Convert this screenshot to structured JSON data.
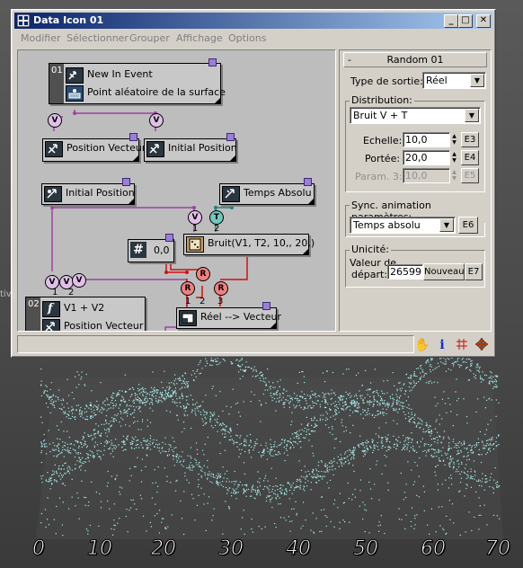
{
  "window": {
    "title": "Data Icon 01",
    "buttons": {
      "minimize": "_",
      "maximize": "□",
      "close": "✕"
    }
  },
  "menu": [
    "Modifier",
    "Sélectionner",
    "Grouper",
    "Affichage",
    "Options"
  ],
  "graph": {
    "node_new_event": {
      "id": "01",
      "line1": "New In Event",
      "line2": "Point aléatoire de la surface"
    },
    "node_pos_vect_1": {
      "label": "Position Vecteur"
    },
    "node_initial_pos_1": {
      "label": "Initial Position"
    },
    "node_initial_pos_2": {
      "label": "Initial Position"
    },
    "node_temps_absolu": {
      "label": "Temps Absolu"
    },
    "node_constant": {
      "icon_text": "#",
      "value": "0,0"
    },
    "node_noise": {
      "label": "Bruit(V1, T2, 10,, 20,)"
    },
    "node_output": {
      "id": "02",
      "line1": "V1 + V2",
      "line2": "Position Vecteur"
    },
    "node_real_vect": {
      "label": "Réel --> Vecteur"
    },
    "circles": {
      "v": "V",
      "t": "T",
      "r": "R"
    },
    "port_numbers": {
      "one": "1",
      "two": "2",
      "three": "3"
    }
  },
  "panel": {
    "rollout_title": "Random 01",
    "rollout_toggle": "-",
    "output_type_label": "Type de sortie:",
    "output_type_value": "Réel",
    "distribution_label": "Distribution:",
    "distribution_value": "Bruit V + T",
    "scale_label": "Echelle:",
    "scale_value": "10,0",
    "scale_btn": "E3",
    "range_label": "Portée:",
    "range_value": "20,0",
    "range_btn": "E4",
    "param3_label": "Param. 3:",
    "param3_value": "10,0",
    "param3_btn": "E5",
    "sync_label": "Sync. animation paramètres:",
    "sync_value": "Temps absolu",
    "sync_btn": "E6",
    "unicity_label": "Unicité:",
    "seed_label_1": "Valeur de",
    "seed_label_2": "départ:",
    "seed_value": "26599",
    "new_btn": "Nouveau",
    "new_btn_e": "E7"
  },
  "status_icons": [
    "hand-icon",
    "info-icon",
    "grid-icon",
    "move-icon"
  ],
  "viewport": {
    "left_label": "tiv",
    "ticks": [
      "0",
      "10",
      "20",
      "30",
      "40",
      "50",
      "60",
      "70"
    ],
    "particle_color": "#a8f0ec"
  }
}
